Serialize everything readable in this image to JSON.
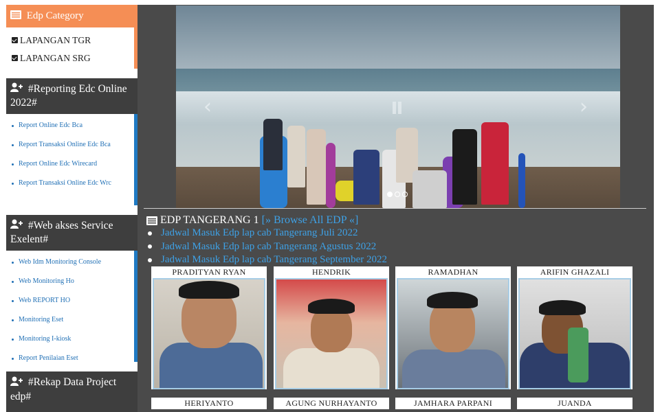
{
  "sidebar": {
    "category": {
      "title": "Edp Category",
      "icon": "list-icon",
      "items": [
        "LAPANGAN TGR",
        "LAPANGAN SRG"
      ]
    },
    "reporting": {
      "title": "#Reporting Edc Online 2022#",
      "icon": "user-plus-icon",
      "items": [
        "Report Online Edc Bca",
        "Report Transaksi Online Edc Bca",
        "Report Online Edc Wirecard",
        "Report Transaksi Online Edc Wrc"
      ]
    },
    "web_akses": {
      "title": "#Web akses Service Exelent#",
      "icon": "user-plus-icon",
      "items": [
        "Web Idm Monitoring Console",
        "Web Monitoring Ho",
        "Web REPORT HO",
        "Monitoring Eset",
        "Monitoring I-kiosk",
        "Report Penilaian Eset"
      ]
    },
    "rekap": {
      "title": "#Rekap Data Project edp#",
      "icon": "user-plus-icon"
    }
  },
  "slider": {
    "prev_icon": "chevron-left-icon",
    "next_icon": "chevron-right-icon",
    "pause_icon": "pause-icon",
    "indicator_count": 3
  },
  "edp": {
    "title": "EDP TANGERANG 1",
    "browse_label": "[» Browse All EDP «]",
    "schedules": [
      "Jadwal Masuk Edp lap cab Tangerang Juli 2022",
      "Jadwal Masuk Edp lap cab Tangerang Agustus 2022",
      "Jadwal Masuk Edp lap cab Tangerang September 2022"
    ],
    "staff": [
      "PRADITYAN RYAN",
      "HENDRIK",
      "RAMADHAN",
      "ARIFIN GHAZALI",
      "HERIYANTO",
      "AGUNG NURHAYANTO",
      "JAMHARA PARPANI",
      "JUANDA"
    ]
  },
  "colors": {
    "orange": "#f58e55",
    "dark": "#4a4a4a",
    "link": "#3ea1e6",
    "accent_blue": "#1f7ac3"
  }
}
